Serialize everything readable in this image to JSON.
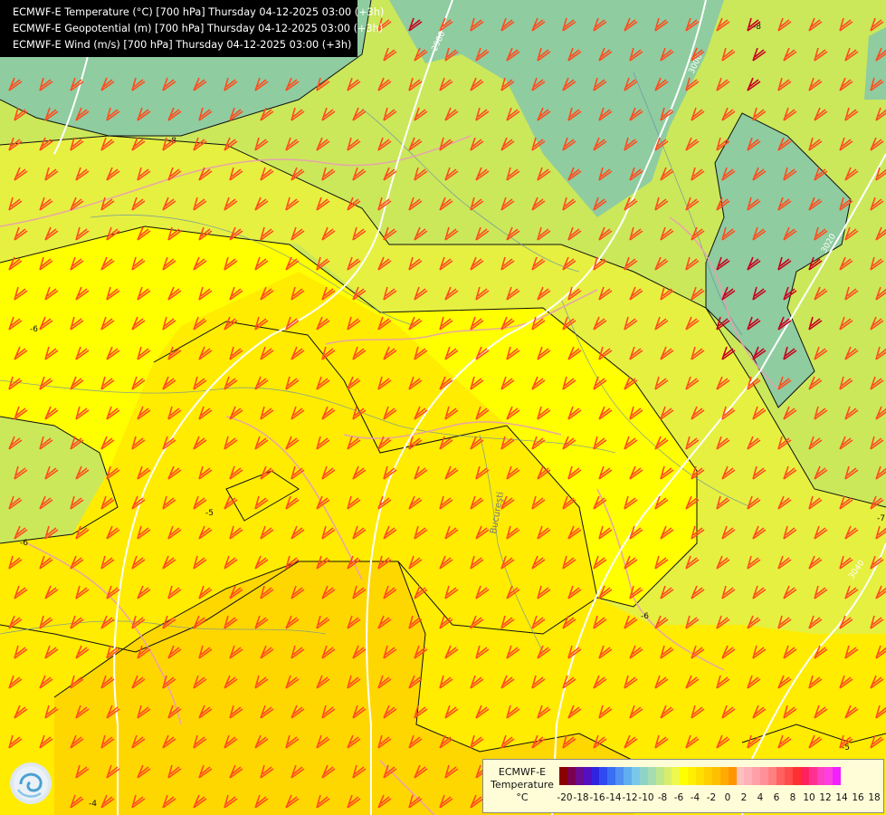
{
  "header": {
    "lines": [
      "ECMWF-E Temperature (°C) [700 hPa] Thursday 04-12-2025 03:00 (+3h)",
      "ECMWF-E Geopotential (m) [700 hPa] Thursday 04-12-2025 03:00 (+3h)",
      "ECMWF-E Wind (m/s) [700 hPa] Thursday 04-12-2025 03:00 (+3h)"
    ]
  },
  "legend": {
    "title_lines": [
      "ECMWF-E",
      "Temperature",
      "°C"
    ],
    "colors": [
      "#8b0000",
      "#7a0050",
      "#6a0a90",
      "#5410c0",
      "#2f23e0",
      "#2f4bf0",
      "#3a6ef5",
      "#4f90f2",
      "#62aef0",
      "#79c8e8",
      "#8fd3c8",
      "#a6ddb0",
      "#bfe68c",
      "#d8ee6a",
      "#eff84d",
      "#ffff00",
      "#fff000",
      "#ffdf00",
      "#ffcf00",
      "#ffbf00",
      "#ffaa00",
      "#ff9500",
      "#ffc0c0",
      "#ffb0b8",
      "#ffa0a8",
      "#ff9098",
      "#ff8080",
      "#ff6060",
      "#ff4b4b",
      "#ff3030",
      "#ff2060",
      "#ff3090",
      "#ff40c0",
      "#ff40e0",
      "#f020ff"
    ],
    "ticks": [
      "-20",
      "-18",
      "-16",
      "-14",
      "-12",
      "-10",
      "-8",
      "-6",
      "-4",
      "-2",
      "0",
      "2",
      "4",
      "6",
      "8",
      "10",
      "12",
      "14",
      "16",
      "18"
    ]
  },
  "contour_labels": {
    "temperature": [
      "-8",
      "-6",
      "-5",
      "-6",
      "-7",
      "-6",
      "-5",
      "-4",
      "-8"
    ],
    "geopotential": [
      "2980",
      "3000",
      "3020",
      "3040"
    ]
  },
  "place_labels": [
    "Bucureşti"
  ],
  "logo": {
    "icon": "ecmwf-swirl-logo"
  },
  "map_colors": {
    "cold_teal": "#8fcca0",
    "green_yellow": "#cbe85a",
    "yellow_green": "#e6f040",
    "yellow": "#ffff00",
    "warm_yellow": "#ffec00",
    "orange_yellow": "#ffd700",
    "barb_color": "#ff4b1e",
    "dark_barb_color": "#c8001e",
    "border_color": "#e8a0b0",
    "river_color": "#6b8fa8",
    "isotherm_color": "#111111",
    "isohypse_color": "#ffffff"
  }
}
